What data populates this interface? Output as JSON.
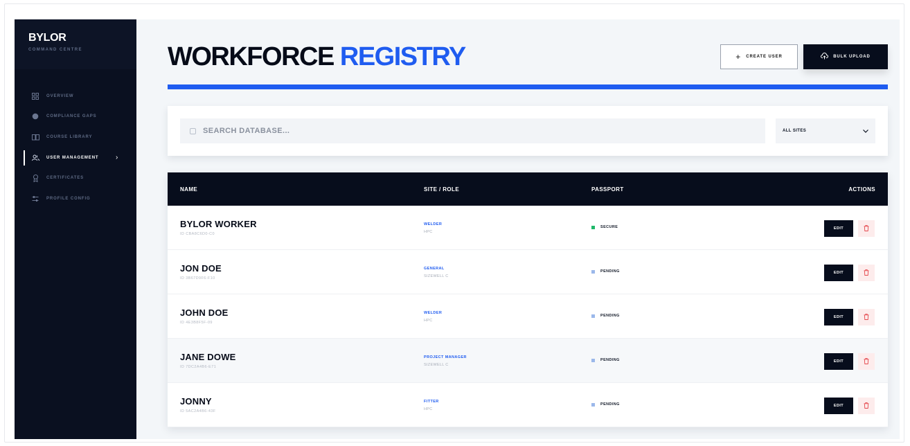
{
  "brand": {
    "title": "BYLOR",
    "subtitle": "COMMAND CENTRE"
  },
  "sidebar": {
    "items": [
      {
        "label": "OVERVIEW",
        "icon": "grid-icon"
      },
      {
        "label": "COMPLIANCE GAPS",
        "icon": "globe-icon"
      },
      {
        "label": "COURSE LIBRARY",
        "icon": "book-icon"
      },
      {
        "label": "USER MANAGEMENT",
        "icon": "users-icon",
        "active": true
      },
      {
        "label": "CERTIFICATES",
        "icon": "award-icon"
      },
      {
        "label": "PROFILE CONFIG",
        "icon": "sliders-icon"
      }
    ]
  },
  "header": {
    "title_part1": "WORKFORCE",
    "title_part2": "REGISTRY",
    "create_label": "CREATE USER",
    "upload_label": "BULK UPLOAD"
  },
  "search": {
    "placeholder": "SEARCH DATABASE...",
    "site_filter": "ALL SITES"
  },
  "table": {
    "headers": {
      "name": "NAME",
      "site_role": "SITE / ROLE",
      "passport": "PASSPORT",
      "actions": "ACTIONS"
    },
    "edit_label": "EDIT",
    "rows": [
      {
        "name": "BYLOR WORKER",
        "id": "ID CBA8C6D0-C0",
        "role": "WELDER",
        "site": "HPC",
        "status": "SECURE",
        "status_color": "#1fb86a"
      },
      {
        "name": "JON DOE",
        "id": "ID 3B67D9F6-F10",
        "role": "GENERAL",
        "site": "SIZEWELL C",
        "status": "PENDING",
        "status_color": "#9bb8ea"
      },
      {
        "name": "JOHN DOE",
        "id": "ID 4E3B8F5F-09",
        "role": "WELDER",
        "site": "HPC",
        "status": "PENDING",
        "status_color": "#9bb8ea"
      },
      {
        "name": "JANE DOWE",
        "id": "ID 7DC2A4B6-E71",
        "role": "PROJECT MANAGER",
        "site": "SIZEWELL C",
        "status": "PENDING",
        "status_color": "#9bb8ea"
      },
      {
        "name": "JONNY",
        "id": "ID 5AC2A4B6-43F",
        "role": "FITTER",
        "site": "HPC",
        "status": "PENDING",
        "status_color": "#9bb8ea"
      }
    ]
  },
  "colors": {
    "accent": "#1f5cf0",
    "dark": "#070d1c",
    "danger": "#e5484d"
  }
}
